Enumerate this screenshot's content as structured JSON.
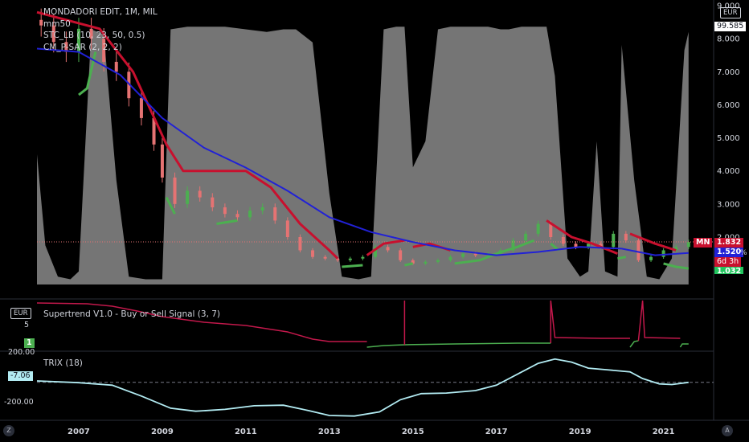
{
  "main_legend": {
    "title": "MONDADORI EDIT, 1M, MIL",
    "ind1": "mm50",
    "ind2": "STC_LB (10, 23, 50, 0.5)",
    "ind3": "CM_P-SAR (2, 2, 2)"
  },
  "right_axis": {
    "currency": "EUR",
    "ticks": [
      "9.000",
      "8.000",
      "7.000",
      "6.000",
      "5.000",
      "4.000",
      "3.000",
      "2.000"
    ],
    "stc_value": "99.585",
    "mn_label": "MN",
    "price": "1.832",
    "ma_value": "1.520",
    "countdown": "6d 3h",
    "sar_value": "1.032",
    "pct_sign": "%"
  },
  "supertrend": {
    "title": "Supertrend V1.0 - Buy or Sell Signal (3, 7)",
    "scale_label": "EUR",
    "tick": "5",
    "signal_value": "1"
  },
  "trix": {
    "title": "TRIX (18)",
    "tick_top": "200.00",
    "tick_bottom": "-200.00",
    "value": "-7.06"
  },
  "time_axis": [
    "2007",
    "2009",
    "2011",
    "2013",
    "2015",
    "2017",
    "2019",
    "2021"
  ],
  "corner_left": "Z",
  "corner_right": "A",
  "colors": {
    "bg": "#000000",
    "stc_fill": "#8a8a8a",
    "ma": "#2121d6",
    "sar_sell": "#c8102e",
    "sar_buy": "#4caf50",
    "supertrend_down": "#c2184b",
    "supertrend_up": "#4caf50",
    "trix": "#b2ebf2",
    "candle_up": "#4caf50",
    "candle_down": "#e57373"
  },
  "chart_data": [
    {
      "type": "line",
      "name": "price_panel",
      "x_range": [
        2006.0,
        2021.7
      ],
      "ylim": [
        1.0,
        9.2
      ],
      "price_series": {
        "x": [
          2006.1,
          2006.4,
          2006.7,
          2007.0,
          2007.3,
          2007.6,
          2007.9,
          2008.2,
          2008.5,
          2008.8,
          2009.0,
          2009.3,
          2009.6,
          2009.9,
          2010.2,
          2010.5,
          2010.8,
          2011.1,
          2011.4,
          2011.7,
          2012.0,
          2012.3,
          2012.6,
          2012.9,
          2013.2,
          2013.5,
          2013.8,
          2014.1,
          2014.4,
          2014.7,
          2015.0,
          2015.3,
          2015.6,
          2015.9,
          2016.2,
          2016.5,
          2016.8,
          2017.1,
          2017.4,
          2017.7,
          2018.0,
          2018.3,
          2018.6,
          2018.9,
          2019.2,
          2019.5,
          2019.8,
          2020.1,
          2020.4,
          2020.7,
          2021.0,
          2021.3,
          2021.6
        ],
        "close": [
          8.4,
          7.9,
          7.6,
          8.3,
          8.0,
          7.3,
          7.0,
          6.2,
          5.6,
          4.8,
          3.8,
          3.0,
          3.4,
          3.2,
          2.9,
          2.7,
          2.6,
          2.8,
          2.9,
          2.5,
          2.0,
          1.6,
          1.4,
          1.35,
          1.3,
          1.35,
          1.4,
          1.7,
          1.6,
          1.3,
          1.2,
          1.25,
          1.3,
          1.4,
          1.5,
          1.45,
          1.5,
          1.6,
          1.9,
          2.1,
          2.4,
          2.0,
          1.8,
          1.7,
          1.8,
          1.7,
          2.1,
          1.9,
          1.3,
          1.4,
          1.6,
          1.7,
          1.85
        ]
      },
      "ma50": {
        "x": [
          2006.0,
          2007.0,
          2008.0,
          2009.0,
          2010.0,
          2011.0,
          2012.0,
          2013.0,
          2014.0,
          2015.0,
          2016.0,
          2017.0,
          2018.0,
          2019.0,
          2020.0,
          2020.8,
          2021.6
        ],
        "y": [
          7.7,
          7.6,
          6.9,
          5.6,
          4.7,
          4.1,
          3.4,
          2.6,
          2.15,
          1.85,
          1.6,
          1.45,
          1.55,
          1.7,
          1.65,
          1.45,
          1.52
        ]
      },
      "stc_fill_0_100": {
        "x": [
          2006.0,
          2006.2,
          2006.5,
          2006.8,
          2007.0,
          2007.3,
          2007.6,
          2007.9,
          2008.2,
          2008.6,
          2009.0,
          2009.2,
          2009.6,
          2010.0,
          2010.5,
          2011.0,
          2011.5,
          2011.9,
          2012.2,
          2012.6,
          2013.0,
          2013.3,
          2013.7,
          2014.0,
          2014.3,
          2014.6,
          2014.8,
          2015.0,
          2015.3,
          2015.6,
          2015.9,
          2016.2,
          2016.5,
          2016.8,
          2017.1,
          2017.3,
          2017.6,
          2017.9,
          2018.2,
          2018.4,
          2018.7,
          2019.0,
          2019.2,
          2019.4,
          2019.6,
          2019.9,
          2020.0,
          2020.3,
          2020.6,
          2020.9,
          2021.2,
          2021.5,
          2021.6
        ],
        "y": [
          50,
          15,
          3,
          2,
          5,
          98,
          96,
          40,
          3,
          2,
          2,
          98,
          99,
          99,
          99,
          98,
          97,
          98,
          98,
          93,
          35,
          3,
          2,
          3,
          98,
          99,
          99,
          45,
          55,
          98,
          99,
          99,
          99,
          99,
          98,
          98,
          99,
          99,
          99,
          80,
          10,
          3,
          5,
          55,
          5,
          3,
          92,
          40,
          3,
          2,
          10,
          90,
          97
        ]
      }
    },
    {
      "type": "line",
      "name": "supertrend_panel",
      "tick_label": "5",
      "signal_years": [
        2013.9,
        2018.3,
        2020.2,
        2021.4
      ]
    },
    {
      "type": "line",
      "name": "trix_panel",
      "ylim": [
        -300,
        250
      ],
      "ticks": [
        200,
        -200
      ],
      "x": [
        2006.0,
        2007.0,
        2007.8,
        2008.5,
        2009.2,
        2009.8,
        2010.5,
        2011.2,
        2011.9,
        2012.5,
        2013.0,
        2013.6,
        2014.2,
        2014.7,
        2015.2,
        2015.8,
        2016.5,
        2017.0,
        2017.5,
        2018.0,
        2018.4,
        2018.8,
        2019.2,
        2019.7,
        2020.2,
        2020.5,
        2020.9,
        2021.2,
        2021.6
      ],
      "y": [
        5,
        -10,
        -30,
        -120,
        -220,
        -245,
        -230,
        -200,
        -195,
        -240,
        -280,
        -285,
        -250,
        -150,
        -100,
        -95,
        -75,
        -30,
        60,
        150,
        185,
        160,
        110,
        95,
        80,
        25,
        -20,
        -25,
        -7
      ]
    }
  ]
}
